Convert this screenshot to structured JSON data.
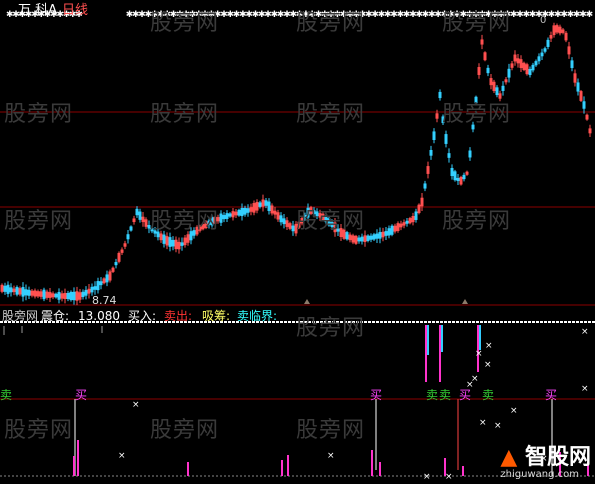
{
  "title_bar": {
    "stock": "万 科A",
    "period": "日线"
  },
  "watermark": "股旁网",
  "top_panel": {
    "price_low_label": "8.74",
    "top_right_label": "0"
  },
  "indicator_bar": {
    "prefix": "股旁网",
    "label_zhenhe": "震仓:",
    "value": "13.080",
    "label_buy": "买入:",
    "label_sell_out": "卖出:",
    "label_xichou": "吸筹:",
    "label_sell_critical": "卖临界:"
  },
  "signals": [
    {
      "text": "卖",
      "color": "#33cc33"
    },
    {
      "text": "买",
      "color": "#ff44ff"
    },
    {
      "text": "买",
      "color": "#ff44ff"
    },
    {
      "text": "卖",
      "color": "#33cc33"
    },
    {
      "text": "卖",
      "color": "#33cc33"
    },
    {
      "text": "买",
      "color": "#ff44ff"
    },
    {
      "text": "卖",
      "color": "#33cc33"
    },
    {
      "text": "买",
      "color": "#ff44ff"
    }
  ],
  "logo": {
    "name": "智股网",
    "url": "zhiguwang.com"
  },
  "colors": {
    "up": "#ff5050",
    "down": "#33d0ff",
    "grid": "#8b0000",
    "magenta": "#ff33cc",
    "cyan": "#33ccff",
    "white": "#ffffff"
  }
}
